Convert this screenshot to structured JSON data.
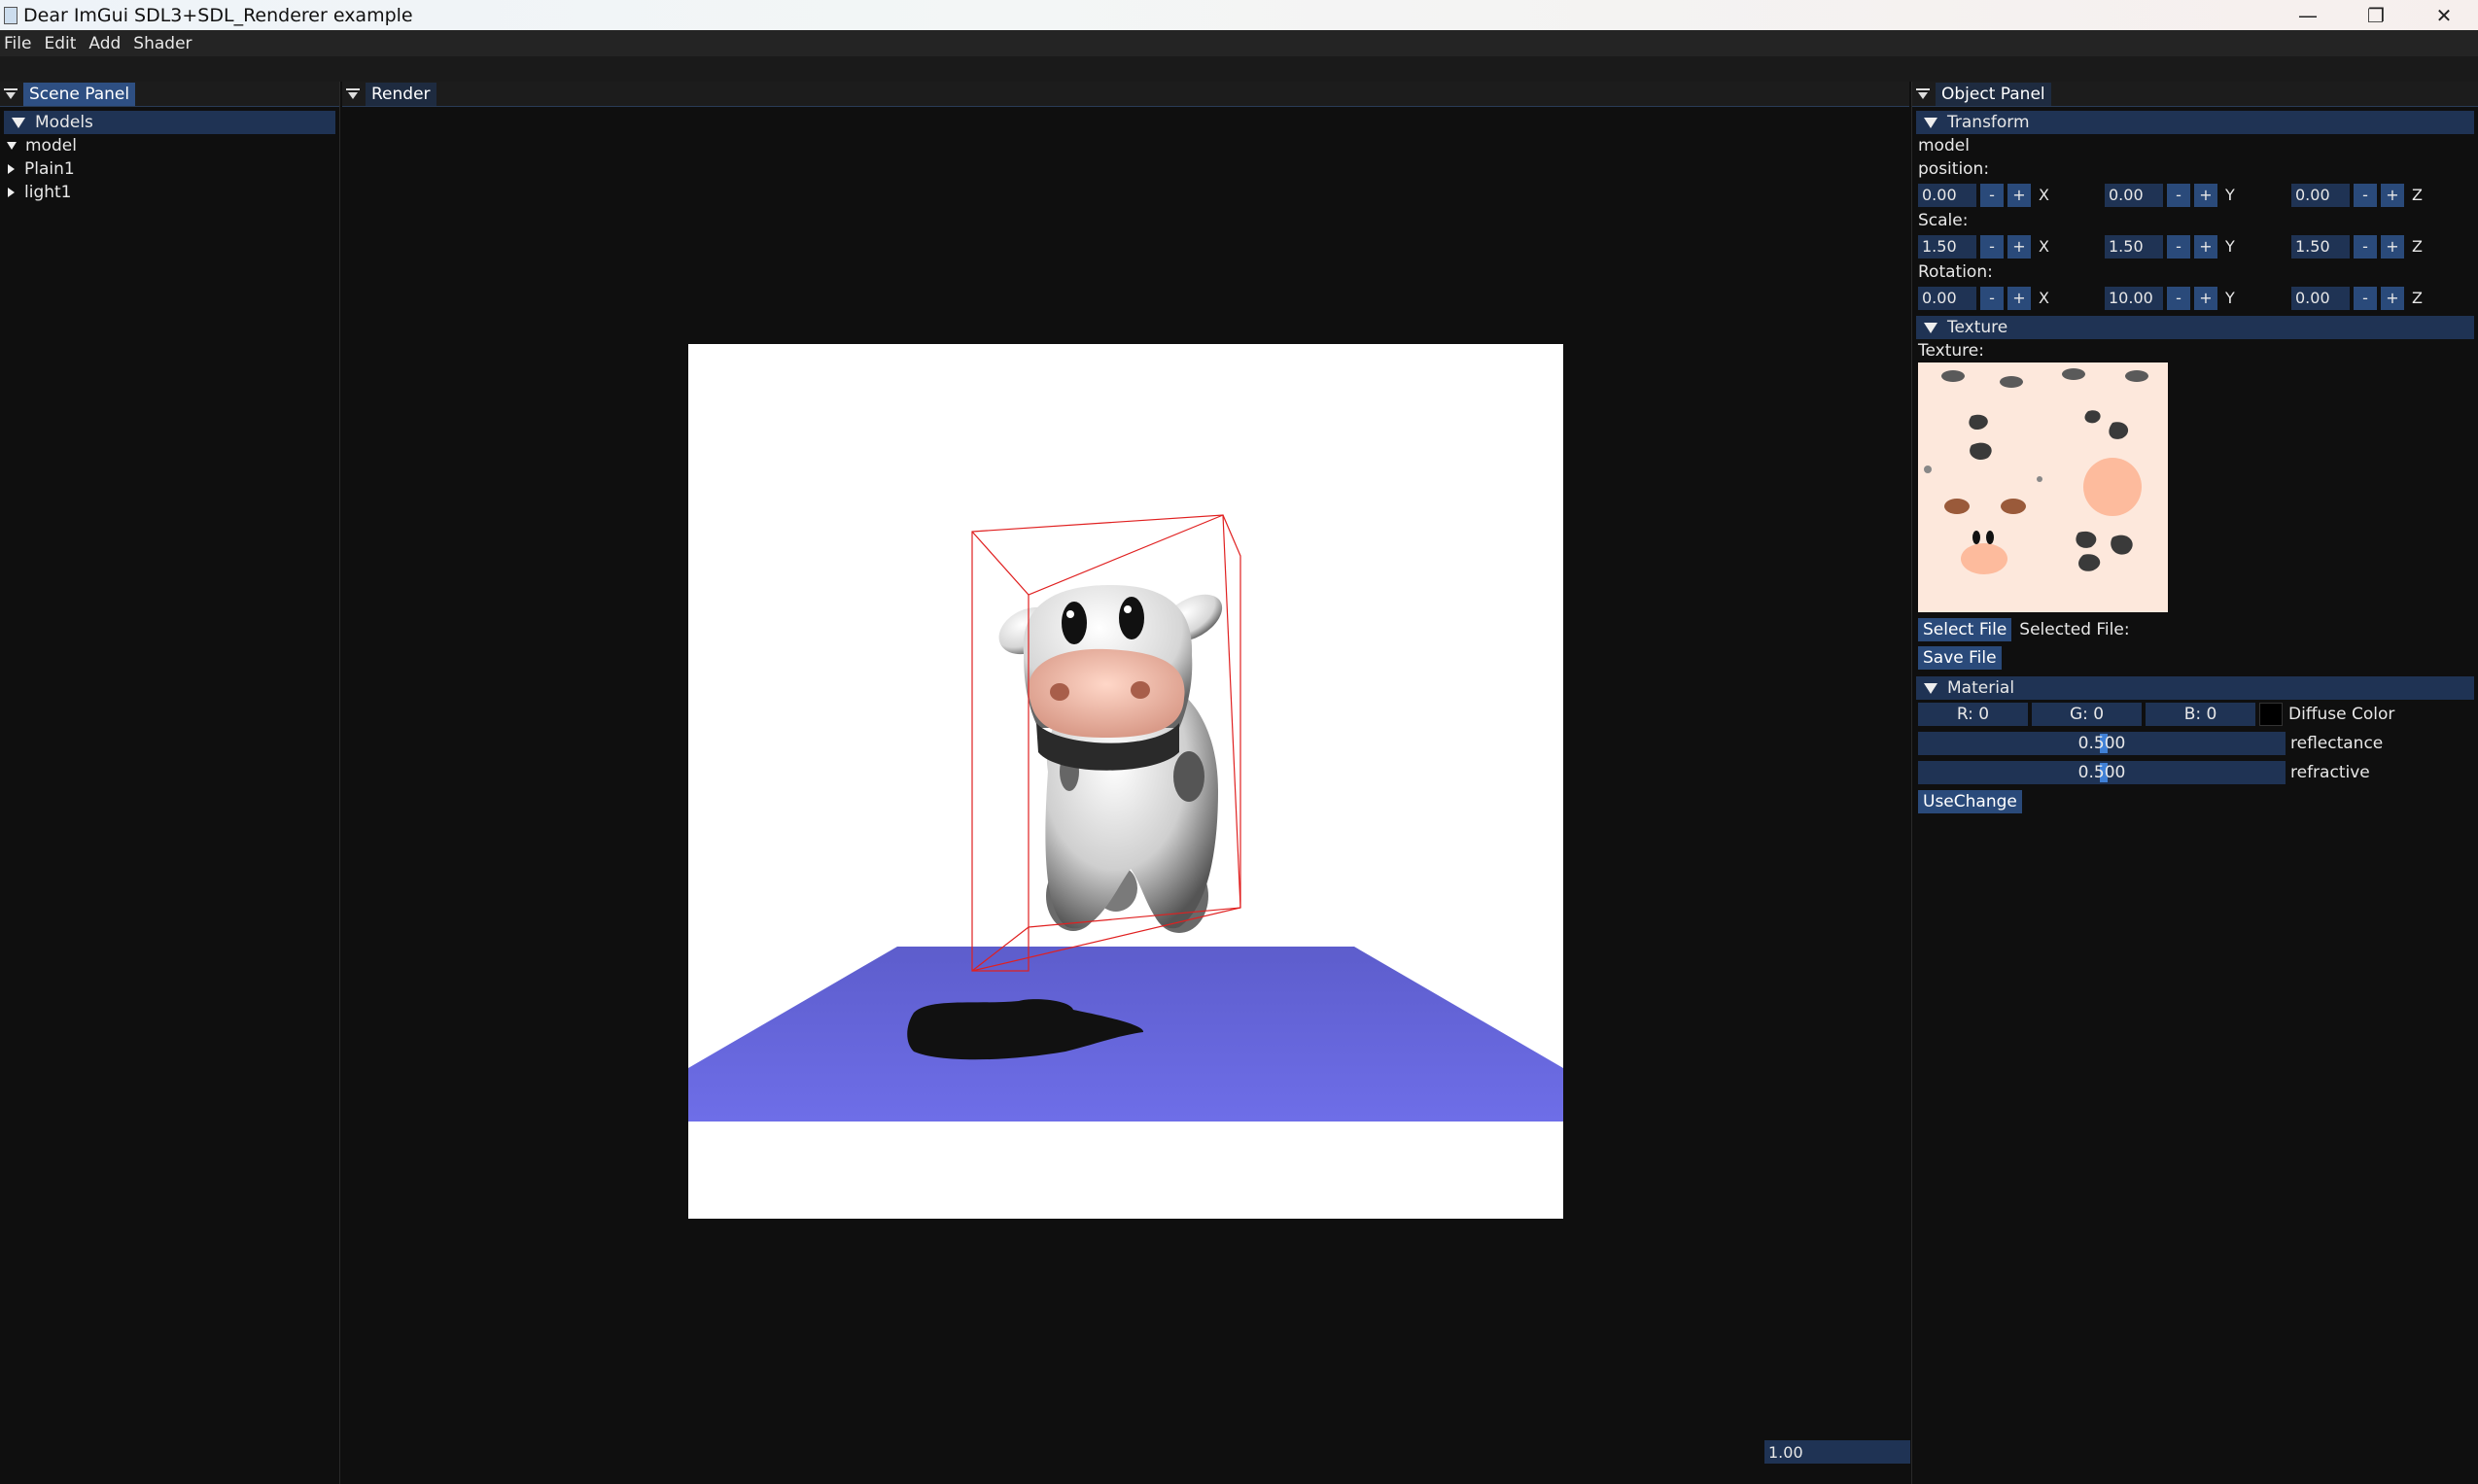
{
  "window": {
    "title": "Dear ImGui SDL3+SDL_Renderer example",
    "minimize": "—",
    "restore": "❐",
    "close": "✕"
  },
  "menu": [
    "File",
    "Edit",
    "Add",
    "Shader"
  ],
  "scene_panel": {
    "title": "Scene Panel",
    "models_header": "Models",
    "items": [
      {
        "label": "model",
        "expanded": true
      },
      {
        "label": "Plain1",
        "expanded": false
      },
      {
        "label": "light1",
        "expanded": false
      }
    ]
  },
  "render_panel": {
    "title": "Render",
    "zoom_value": "1.00",
    "background": "#ffffff",
    "plane_color": "#6b6be0",
    "bbox_color": "#e02020"
  },
  "object_panel": {
    "title": "Object Panel",
    "transform": {
      "header": "Transform",
      "object_name": "model",
      "position_label": "position:",
      "position": [
        "0.00",
        "0.00",
        "0.00"
      ],
      "scale_label": "Scale:",
      "scale": [
        "1.50",
        "1.50",
        "1.50"
      ],
      "rotation_label": "Rotation:",
      "rotation": [
        "0.00",
        "10.00",
        "0.00"
      ],
      "axes": [
        "X",
        "Y",
        "Z"
      ],
      "minus": "-",
      "plus": "+"
    },
    "texture": {
      "header": "Texture",
      "label": "Texture:",
      "select_button": "Select File",
      "selected_label": "Selected File:",
      "save_button": "Save File"
    },
    "material": {
      "header": "Material",
      "r": "R: 0",
      "g": "G: 0",
      "b": "B: 0",
      "diffuse_label": "Diffuse Color",
      "reflectance": "0.500",
      "reflectance_label": "reflectance",
      "refractive": "0.500",
      "refractive_label": "refractive",
      "use_button": "UseChange"
    }
  }
}
